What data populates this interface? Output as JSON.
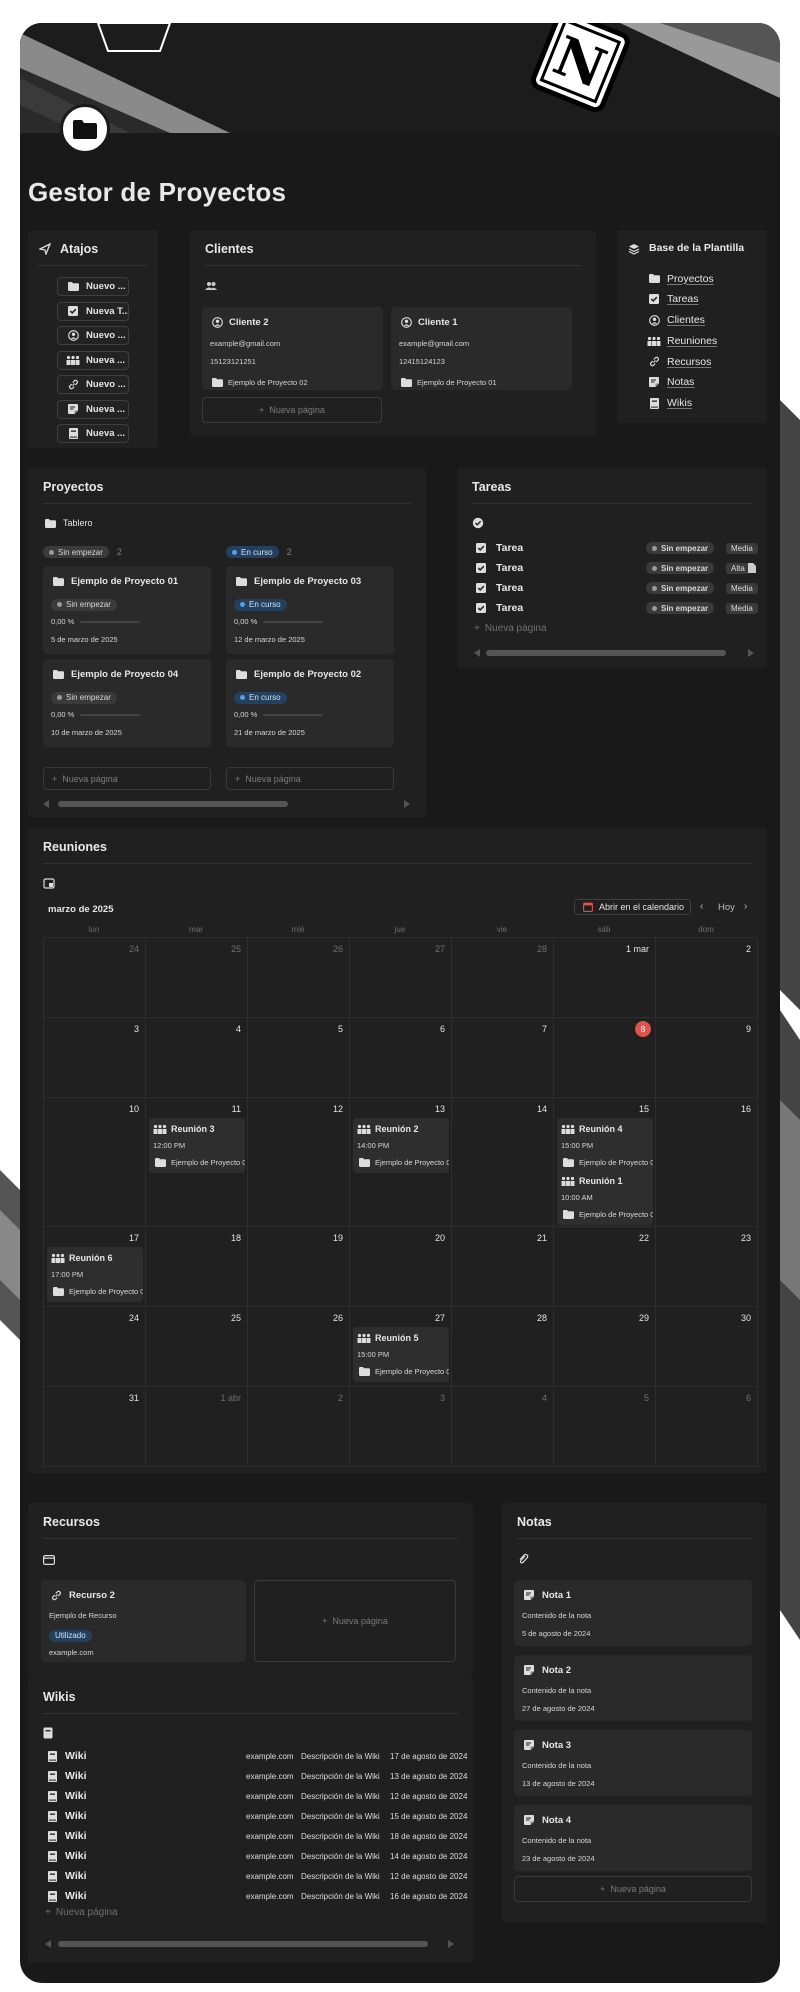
{
  "page": {
    "title": "Gestor de Proyectos",
    "accent_colors": {
      "today": "#e0524a",
      "in_progress": "#5aa0e6",
      "calendar_icon": "#e0524a"
    }
  },
  "shortcuts": {
    "title": "Atajos",
    "icon": "paper-plane-icon",
    "buttons": [
      {
        "label": "Nuevo ...",
        "icon": "folder-icon"
      },
      {
        "label": "Nueva T...",
        "icon": "checkbox-icon"
      },
      {
        "label": "Nuevo ...",
        "icon": "user-circle-icon"
      },
      {
        "label": "Nueva ...",
        "icon": "people-icon"
      },
      {
        "label": "Nuevo ...",
        "icon": "link-icon"
      },
      {
        "label": "Nueva ...",
        "icon": "note-icon"
      },
      {
        "label": "Nueva ...",
        "icon": "book-icon"
      }
    ]
  },
  "clients": {
    "title": "Clientes",
    "cards": [
      {
        "name": "Cliente 2",
        "email": "example@gmail.com",
        "phone": "15123121251",
        "project": "Ejemplo de Proyecto 02"
      },
      {
        "name": "Cliente 1",
        "email": "example@gmail.com",
        "phone": "12415124123",
        "project": "Ejemplo de Proyecto 01"
      }
    ],
    "new_page": "Nueva página"
  },
  "template_base": {
    "title": "Base de la Plantilla",
    "items": [
      {
        "label": "Proyectos",
        "icon": "folder-icon"
      },
      {
        "label": "Tareas",
        "icon": "checkbox-icon"
      },
      {
        "label": "Clientes",
        "icon": "user-circle-icon"
      },
      {
        "label": "Reuniones",
        "icon": "people-icon"
      },
      {
        "label": "Recursos",
        "icon": "link-icon"
      },
      {
        "label": "Notas",
        "icon": "note-icon"
      },
      {
        "label": "Wikis",
        "icon": "book-icon"
      }
    ]
  },
  "projects": {
    "title": "Proyectos",
    "view": "Tablero",
    "columns": [
      {
        "status": "Sin empezar",
        "count": "2",
        "cards": [
          {
            "title": "Ejemplo de Proyecto 01",
            "status": "Sin empezar",
            "progress": "0,00 %",
            "progress_value": 0,
            "date": "5 de marzo de 2025"
          },
          {
            "title": "Ejemplo de Proyecto 04",
            "status": "Sin empezar",
            "progress": "0,00 %",
            "progress_value": 0,
            "date": "10 de marzo de 2025"
          }
        ]
      },
      {
        "status": "En curso",
        "count": "2",
        "cards": [
          {
            "title": "Ejemplo de Proyecto 03",
            "status": "En curso",
            "progress": "0,00 %",
            "progress_value": 0,
            "date": "12 de marzo de 2025"
          },
          {
            "title": "Ejemplo de Proyecto 02",
            "status": "En curso",
            "progress": "0,00 %",
            "progress_value": 0,
            "date": "21 de marzo de 2025"
          }
        ]
      }
    ],
    "new_page": "Nueva página"
  },
  "tasks": {
    "title": "Tareas",
    "rows": [
      {
        "name": "Tarea",
        "status": "Sin empezar",
        "priority": "Media"
      },
      {
        "name": "Tarea",
        "status": "Sin empezar",
        "priority": "Alta"
      },
      {
        "name": "Tarea",
        "status": "Sin empezar",
        "priority": "Media"
      },
      {
        "name": "Tarea",
        "status": "Sin empezar",
        "priority": "Media"
      }
    ],
    "new_page": "Nueva página"
  },
  "meetings": {
    "title": "Reuniones",
    "month": "marzo de 2025",
    "open_calendar": "Abrir en el calendario",
    "today_label": "Hoy",
    "weekdays": [
      "lun",
      "mar",
      "mié",
      "jue",
      "vie",
      "sáb",
      "dom"
    ],
    "weeks": [
      [
        {
          "n": "24",
          "m": true
        },
        {
          "n": "25",
          "m": true
        },
        {
          "n": "26",
          "m": true
        },
        {
          "n": "27",
          "m": true
        },
        {
          "n": "28",
          "m": true
        },
        {
          "n": "1 mar"
        },
        {
          "n": "2"
        }
      ],
      [
        {
          "n": "3"
        },
        {
          "n": "4"
        },
        {
          "n": "5"
        },
        {
          "n": "6"
        },
        {
          "n": "7"
        },
        {
          "n": "8",
          "today": true
        },
        {
          "n": "9"
        }
      ],
      [
        {
          "n": "10"
        },
        {
          "n": "11"
        },
        {
          "n": "12"
        },
        {
          "n": "13"
        },
        {
          "n": "14"
        },
        {
          "n": "15"
        },
        {
          "n": "16"
        }
      ],
      [
        {
          "n": "17"
        },
        {
          "n": "18"
        },
        {
          "n": "19"
        },
        {
          "n": "20"
        },
        {
          "n": "21"
        },
        {
          "n": "22"
        },
        {
          "n": "23"
        }
      ],
      [
        {
          "n": "24"
        },
        {
          "n": "25"
        },
        {
          "n": "26"
        },
        {
          "n": "27"
        },
        {
          "n": "28"
        },
        {
          "n": "29"
        },
        {
          "n": "30"
        }
      ],
      [
        {
          "n": "31"
        },
        {
          "n": "1 abr",
          "m": true
        },
        {
          "n": "2",
          "m": true
        },
        {
          "n": "3",
          "m": true
        },
        {
          "n": "4",
          "m": true
        },
        {
          "n": "5",
          "m": true
        },
        {
          "n": "6",
          "m": true
        }
      ]
    ],
    "events": [
      {
        "title": "Reunión 3",
        "time": "12:00 PM",
        "project": "Ejemplo de Proyecto 0",
        "week": 2,
        "day": 1,
        "slot": 0
      },
      {
        "title": "Reunión 2",
        "time": "14:00 PM",
        "project": "Ejemplo de Proyecto 0",
        "week": 2,
        "day": 3,
        "slot": 0
      },
      {
        "title": "Reunión 4",
        "time": "15:00 PM",
        "project": "Ejemplo de Proyecto 0",
        "week": 2,
        "day": 5,
        "slot": 0
      },
      {
        "title": "Reunión 1",
        "time": "10:00 AM",
        "project": "Ejemplo de Proyecto 0",
        "week": 2,
        "day": 5,
        "slot": 1
      },
      {
        "title": "Reunión 6",
        "time": "17:00 PM",
        "project": "Ejemplo de Proyecto 0",
        "week": 3,
        "day": 0,
        "slot": 0
      },
      {
        "title": "Reunión 5",
        "time": "15:00 PM",
        "project": "Ejemplo de Proyecto 0",
        "week": 4,
        "day": 3,
        "slot": 0
      }
    ]
  },
  "resources": {
    "title": "Recursos",
    "card": {
      "name": "Recurso 2",
      "description": "Ejemplo de Recurso",
      "status": "Utilizado",
      "url": "example.com"
    },
    "new_page": "Nueva página"
  },
  "notes": {
    "title": "Notas",
    "cards": [
      {
        "name": "Nota 1",
        "content": "Contenido de la nota",
        "date": "5 de agosto de 2024"
      },
      {
        "name": "Nota 2",
        "content": "Contenido de la nota",
        "date": "27 de agosto de 2024"
      },
      {
        "name": "Nota 3",
        "content": "Contenido de la nota",
        "date": "13 de agosto de 2024"
      },
      {
        "name": "Nota 4",
        "content": "Contenido de la nota",
        "date": "23 de agosto de 2024"
      }
    ],
    "new_page": "Nueva página"
  },
  "wikis": {
    "title": "Wikis",
    "rows": [
      {
        "name": "Wiki",
        "url": "example.com",
        "description": "Descripción de la Wiki",
        "date": "17 de agosto de 2024"
      },
      {
        "name": "Wiki",
        "url": "example.com",
        "description": "Descripción de la Wiki",
        "date": "13 de agosto de 2024"
      },
      {
        "name": "Wiki",
        "url": "example.com",
        "description": "Descripción de la Wiki",
        "date": "12 de agosto de 2024"
      },
      {
        "name": "Wiki",
        "url": "example.com",
        "description": "Descripción de la Wiki",
        "date": "15 de agosto de 2024"
      },
      {
        "name": "Wiki",
        "url": "example.com",
        "description": "Descripción de la Wiki",
        "date": "18 de agosto de 2024"
      },
      {
        "name": "Wiki",
        "url": "example.com",
        "description": "Descripción de la Wiki",
        "date": "14 de agosto de 2024"
      },
      {
        "name": "Wiki",
        "url": "example.com",
        "description": "Descripción de la Wiki",
        "date": "12 de agosto de 2024"
      },
      {
        "name": "Wiki",
        "url": "example.com",
        "description": "Descripción de la Wiki",
        "date": "16 de agosto de 2024"
      }
    ],
    "new_page": "Nueva página"
  }
}
